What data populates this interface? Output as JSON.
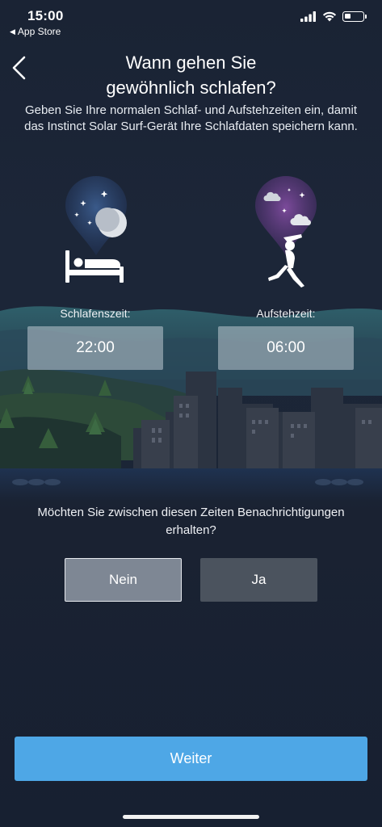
{
  "status_bar": {
    "time": "15:00",
    "back_app": "App Store",
    "icons": [
      "signal-icon",
      "wifi-icon",
      "battery-icon"
    ]
  },
  "header": {
    "title_line1": "Wann gehen Sie",
    "title_line2": "gewöhnlich schlafen?",
    "subtitle": "Geben Sie Ihre normalen Schlaf- und Aufstehzeiten ein, damit das Instinct Solar Surf-Gerät Ihre Schlafdaten speichern kann."
  },
  "sleep": {
    "label": "Schlafenszeit:",
    "value": "22:00"
  },
  "wake": {
    "label": "Aufstehzeit:",
    "value": "06:00"
  },
  "notification": {
    "question": "Möchten Sie zwischen diesen Zeiten Benachrichtigungen erhalten?",
    "no_label": "Nein",
    "yes_label": "Ja",
    "selected": "Nein"
  },
  "footer": {
    "continue_label": "Weiter"
  },
  "colors": {
    "background": "#1a2334",
    "accent": "#4ea7e6",
    "selected_choice": "#7e8794",
    "unselected_choice": "#4b535e"
  }
}
